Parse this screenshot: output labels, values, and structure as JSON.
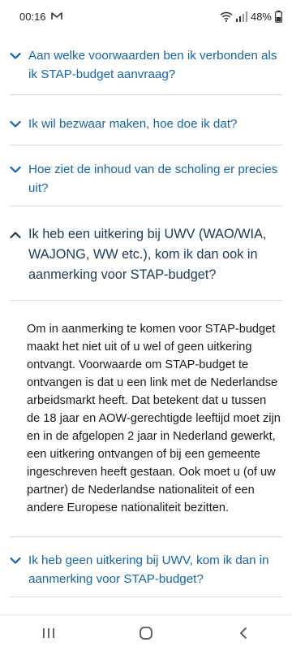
{
  "status_bar": {
    "time": "00:16",
    "battery": "48%"
  },
  "faq": [
    {
      "title": "Aan welke voorwaarden ben ik verbonden als ik STAP-budget aanvraag?",
      "expanded": false,
      "icon": "chevron-down-icon"
    },
    {
      "title": "Ik wil bezwaar maken, hoe doe ik dat?",
      "expanded": false,
      "icon": "chevron-down-icon"
    },
    {
      "title": "Hoe ziet de inhoud van de scholing er precies uit?",
      "expanded": false,
      "icon": "chevron-down-icon"
    },
    {
      "title": "Ik heb een uitkering bij UWV (WAO/WIA, WAJONG, WW etc.), kom ik dan ook in aanmerking voor STAP-budget?",
      "expanded": true,
      "icon": "chevron-up-icon",
      "answer": "Om in aanmerking te komen voor STAP-budget maakt het niet uit of u wel of geen uitkering ontvangt. Voorwaarde om STAP-budget te ontvangen is dat u een link met de Nederlandse arbeidsmarkt heeft. Dat betekent dat u tussen de 18 jaar en AOW-gerechtigde leeftijd moet zijn en in de afgelopen 2 jaar in Nederland gewerkt, een uitkering ontvangen of bij een gemeente ingeschreven heeft gestaan. Ook moet u (of uw partner) de Nederlandse nationaliteit of een andere Europese nationaliteit bezitten."
    },
    {
      "title": "Ik heb geen uitkering bij UWV, kom ik dan in aanmerking voor STAP-budget?",
      "expanded": false,
      "icon": "chevron-down-icon"
    }
  ],
  "nav_bar": {
    "buttons": [
      "recent-apps-icon",
      "home-icon",
      "back-icon"
    ]
  },
  "colors": {
    "link": "#1565a8",
    "expanded_title": "#1c3a58",
    "divider": "#d9d9d9"
  }
}
